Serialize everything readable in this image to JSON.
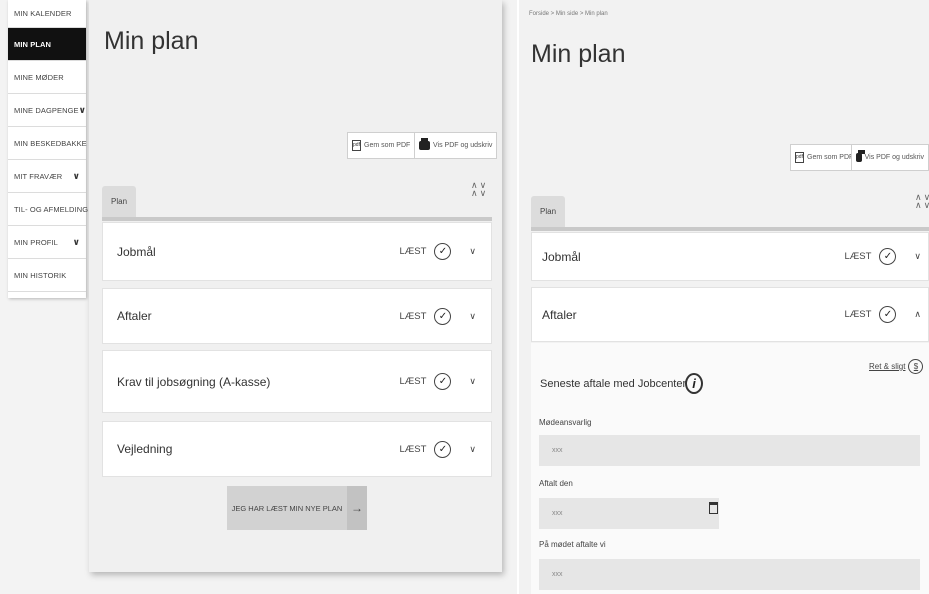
{
  "left": {
    "sidebar": [
      {
        "label": "MIN KALENDER",
        "chevron": ""
      },
      {
        "label": "MIN PLAN",
        "chevron": ""
      },
      {
        "label": "MINE MØDER",
        "chevron": ""
      },
      {
        "label": "MINE DAGPENGE",
        "chevron": "∨"
      },
      {
        "label": "MIN BESKEDBAKKE",
        "chevron": ""
      },
      {
        "label": "MIT FRAVÆR",
        "chevron": "∨"
      },
      {
        "label": "TIL- OG AFMELDING",
        "chevron": ""
      },
      {
        "label": "MIN PROFIL",
        "chevron": "∨"
      },
      {
        "label": "MIN HISTORIK",
        "chevron": ""
      }
    ],
    "title": "Min plan",
    "save_pdf": "Gem som PDF",
    "print_pdf": "Vis PDF og udskriv",
    "tab": "Plan",
    "accordion": [
      {
        "title": "Jobmål",
        "status": "LÆST",
        "chevron": "∨"
      },
      {
        "title": "Aftaler",
        "status": "LÆST",
        "chevron": "∨"
      },
      {
        "title": "Krav til jobsøgning (A-kasse)",
        "status": "LÆST",
        "chevron": "∨"
      },
      {
        "title": "Vejledning",
        "status": "LÆST",
        "chevron": "∨"
      }
    ],
    "confirm_button": "JEG HAR LÆST MIN NYE PLAN",
    "confirm_arrow": "→"
  },
  "right": {
    "breadcrumb": "Forside > Min side > Min plan",
    "title": "Min plan",
    "save_pdf": "Gem som PDF",
    "print_pdf": "Vis PDF og udskriv",
    "tab": "Plan",
    "accordion": [
      {
        "title": "Jobmål",
        "status": "LÆST",
        "chevron": "∨"
      },
      {
        "title": "Aftaler",
        "status": "LÆST",
        "chevron": "∧"
      }
    ],
    "edit_link": "Ret & sligt",
    "edit_link_icon_text": "$",
    "section_title": "Seneste aftale med Jobcenter",
    "info_icon_text": "i",
    "fields": [
      {
        "label": "Mødeansvarlig",
        "value": "xxx"
      },
      {
        "label": "Aftalt den",
        "value": "xxx"
      },
      {
        "label": "På mødet aftalte vi",
        "value": "xxx"
      }
    ]
  },
  "icons": {
    "checkmark": "✓",
    "pdf": "pdf-icon",
    "printer": "printer-icon",
    "updown": "∧∨"
  }
}
